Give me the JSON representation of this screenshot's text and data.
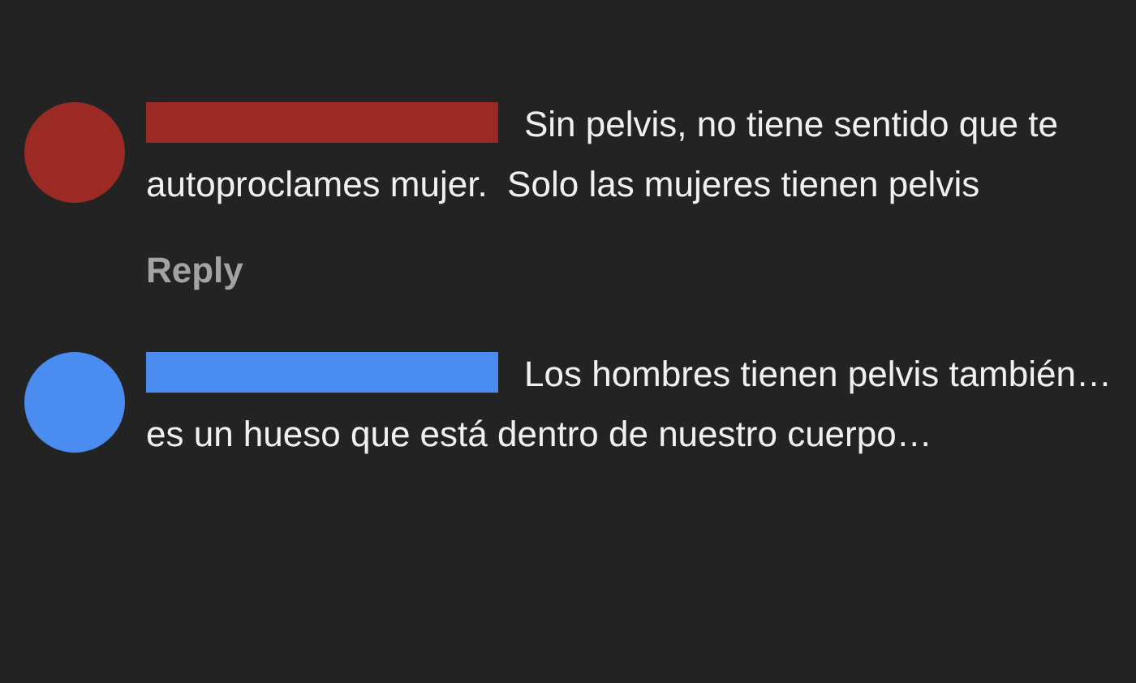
{
  "comments": [
    {
      "color": "#9b2a24",
      "text": "Sin pelvis, no tiene sentido que te autoproclames mujer.  Solo las mujeres tienen pelvis",
      "reply": "Reply"
    },
    {
      "color": "#4a8cf0",
      "text": "Los hombres tienen pelvis también… es un hueso que está dentro de nuestro cuerpo…"
    }
  ]
}
